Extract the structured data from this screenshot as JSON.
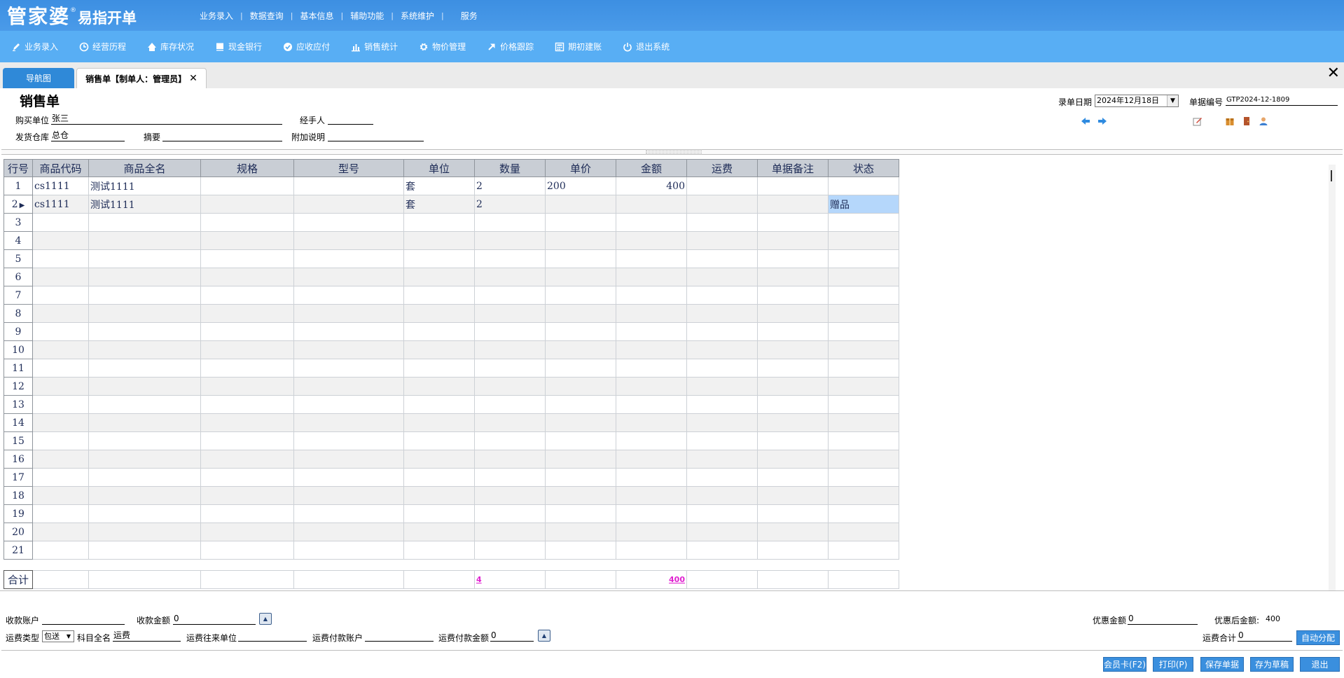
{
  "header": {
    "logo_main": "管家婆",
    "logo_reg": "®",
    "logo_sub": "易指开单",
    "nav": [
      "业务录入",
      "数据查询",
      "基本信息",
      "辅助功能",
      "系统维护",
      "服务"
    ],
    "nav_sep": "|"
  },
  "toolbar": {
    "items": [
      {
        "label": "业务录入",
        "icon": "pen-icon"
      },
      {
        "label": "经营历程",
        "icon": "clock-icon"
      },
      {
        "label": "库存状况",
        "icon": "house-icon"
      },
      {
        "label": "现金银行",
        "icon": "book-icon"
      },
      {
        "label": "应收应付",
        "icon": "check-circle-icon"
      },
      {
        "label": "销售统计",
        "icon": "bar-chart-icon"
      },
      {
        "label": "物价管理",
        "icon": "gear-icon"
      },
      {
        "label": "价格跟踪",
        "icon": "arrow-up-right-icon"
      },
      {
        "label": "期初建账",
        "icon": "calculator-icon"
      },
      {
        "label": "退出系统",
        "icon": "power-icon"
      }
    ]
  },
  "tabs": {
    "nav_tab": "导航图",
    "sales_tab": "销售单【制单人：管理员】",
    "close_glyph": "✕",
    "window_close": "✕"
  },
  "form": {
    "title": "销售单",
    "buyer_label": "购买单位",
    "buyer_value": "张三",
    "handler_label": "经手人",
    "handler_value": "",
    "warehouse_label": "发货仓库",
    "warehouse_value": "总仓",
    "summary_label": "摘要",
    "summary_value": "",
    "note_label": "附加说明",
    "note_value": "",
    "date_label": "录单日期",
    "date_value": "2024年12月18日",
    "docno_label": "单据编号",
    "docno_value": "GTP2024-12-1809"
  },
  "grid": {
    "columns": [
      "行号",
      "商品代码",
      "商品全名",
      "规格",
      "型号",
      "单位",
      "数量",
      "单价",
      "金额",
      "运费",
      "单据备注",
      "状态"
    ],
    "rows": [
      {
        "no": "1",
        "code": "cs1111",
        "name": "测试1111",
        "spec": "",
        "model": "",
        "unit": "套",
        "qty": "2",
        "price": "200",
        "amount": "400",
        "freight": "",
        "remark": "",
        "status": ""
      },
      {
        "no": "2",
        "code": "cs1111",
        "name": "测试1111",
        "spec": "",
        "model": "",
        "unit": "套",
        "qty": "2",
        "price": "",
        "amount": "",
        "freight": "",
        "remark": "",
        "status": "赠品"
      },
      {
        "no": "3"
      },
      {
        "no": "4"
      },
      {
        "no": "5"
      },
      {
        "no": "6"
      },
      {
        "no": "7"
      },
      {
        "no": "8"
      },
      {
        "no": "9"
      },
      {
        "no": "10"
      },
      {
        "no": "11"
      },
      {
        "no": "12"
      },
      {
        "no": "13"
      },
      {
        "no": "14"
      },
      {
        "no": "15"
      },
      {
        "no": "16"
      },
      {
        "no": "17"
      },
      {
        "no": "18"
      },
      {
        "no": "19"
      },
      {
        "no": "20"
      },
      {
        "no": "21"
      }
    ],
    "current_row_marker": "▶",
    "totals": {
      "label": "合计",
      "qty": "4",
      "amount": "400"
    }
  },
  "bottom": {
    "receive_account_label": "收款账户",
    "receive_account_value": "",
    "receive_amount_label": "收款金额",
    "receive_amount_value": "0",
    "discount_label": "优惠金额",
    "discount_value": "0",
    "after_discount_label": "优惠后金额:",
    "after_discount_value": "400",
    "freight_type_label": "运费类型",
    "freight_type_value": "包送",
    "subject_label": "科目全名",
    "subject_value": "运费",
    "freight_unit_label": "运费往来单位",
    "freight_unit_value": "",
    "freight_account_label": "运费付款账户",
    "freight_account_value": "",
    "freight_pay_label": "运费付款金额",
    "freight_pay_value": "0",
    "freight_total_label": "运费合计",
    "freight_total_value": "0",
    "auto_alloc": "自动分配",
    "buttons": [
      "会员卡(F2)",
      "打印(P)",
      "保存单据",
      "存为草稿",
      "退出"
    ]
  }
}
